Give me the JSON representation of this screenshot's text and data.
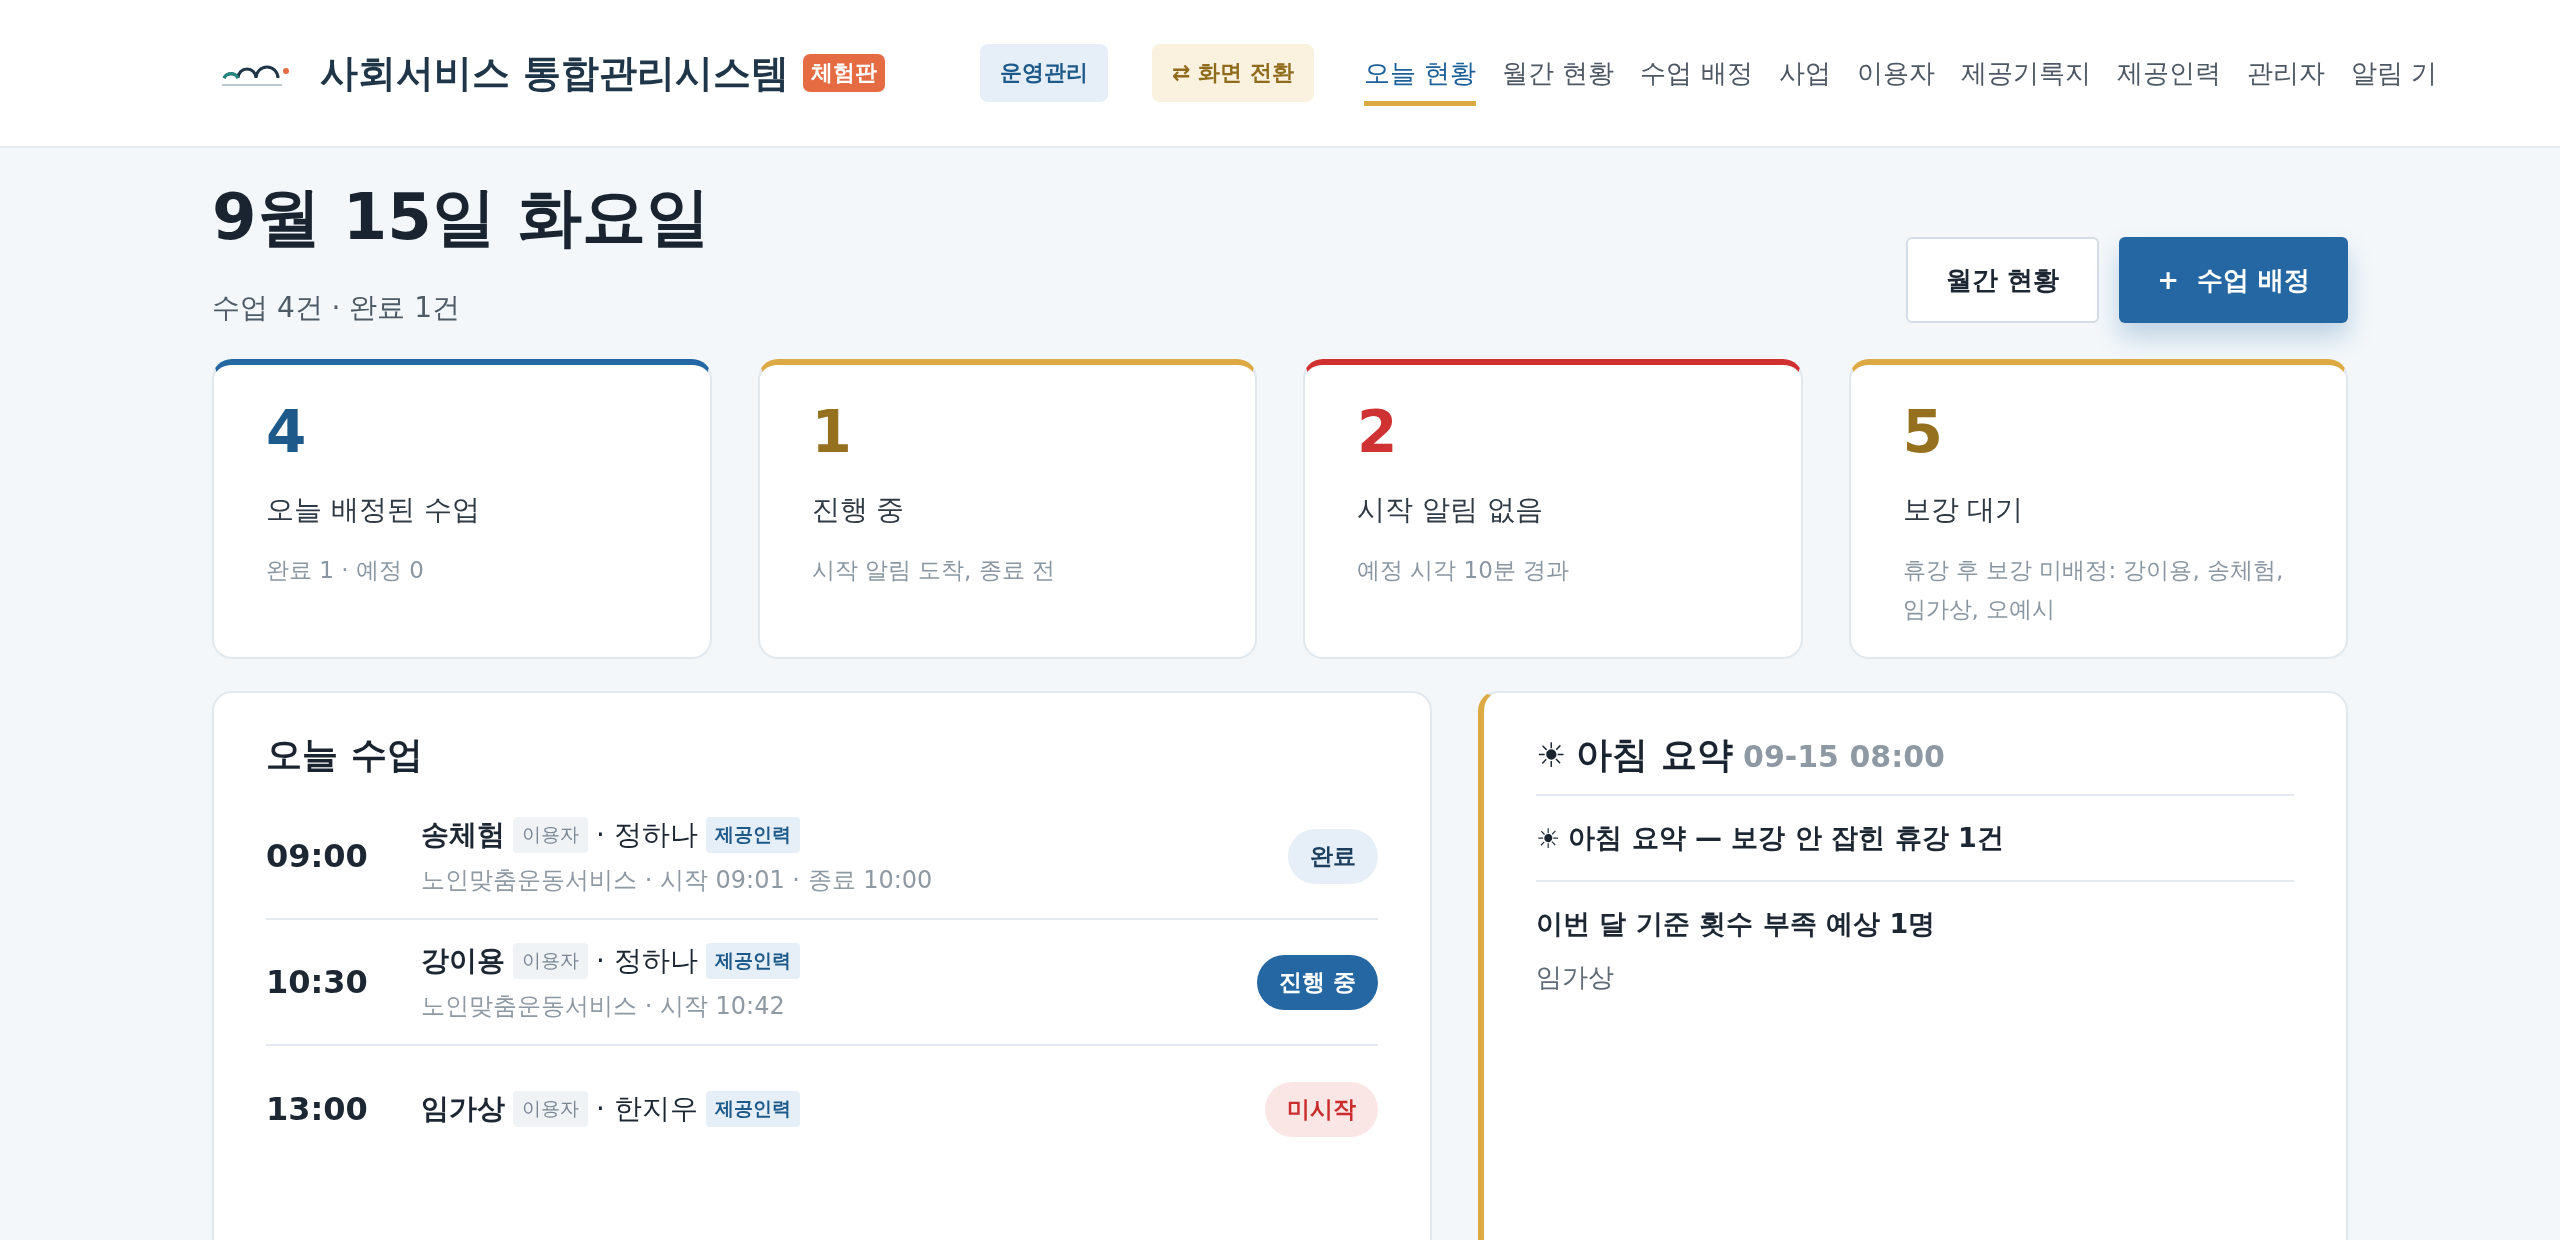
{
  "header": {
    "title": "사회서비스 통합관리시스템",
    "badge": "체험판",
    "ops_button": "운영관리",
    "switch_button": {
      "icon": "⇄",
      "label": "화면 전환"
    },
    "nav": [
      {
        "label": "오늘 현황",
        "selected": true
      },
      {
        "label": "월간 현황",
        "selected": false
      },
      {
        "label": "수업 배정",
        "selected": false
      },
      {
        "label": "사업",
        "selected": false
      },
      {
        "label": "이용자",
        "selected": false
      },
      {
        "label": "제공기록지",
        "selected": false
      },
      {
        "label": "제공인력",
        "selected": false
      },
      {
        "label": "관리자",
        "selected": false
      },
      {
        "label": "알림 기",
        "selected": false
      }
    ]
  },
  "page": {
    "title": "9월 15일 화요일",
    "subtitle": "수업 4건 · 완료 1건",
    "monthly_button": "월간 현황",
    "assign_button": {
      "icon": "+",
      "label": "수업 배정"
    }
  },
  "stats": [
    {
      "kind": "blue",
      "value": "4",
      "label": "오늘 배정된 수업",
      "detail": "완료 1 · 예정 0"
    },
    {
      "kind": "amber",
      "value": "1",
      "label": "진행 중",
      "detail": "시작 알림 도착, 종료 전"
    },
    {
      "kind": "red",
      "value": "2",
      "label": "시작 알림 없음",
      "detail": "예정 시각 10분 경과"
    },
    {
      "kind": "amber",
      "value": "5",
      "label": "보강 대기",
      "detail": "휴강 후 보강 미배정: 강이용, 송체험, 임가상, 오예시"
    }
  ],
  "today": {
    "title": "오늘 수업",
    "rows": [
      {
        "time": "09:00",
        "client": "송체험",
        "client_tag": "이용자",
        "provider": "· 정하나",
        "provider_tag": "제공인력",
        "detail": "노인맞춤운동서비스 · 시작 09:01 · 종료 10:00",
        "status": {
          "kind": "done",
          "label": "완료"
        }
      },
      {
        "time": "10:30",
        "client": "강이용",
        "client_tag": "이용자",
        "provider": "· 정하나",
        "provider_tag": "제공인력",
        "detail": "노인맞춤운동서비스 · 시작 10:42",
        "status": {
          "kind": "active",
          "label": "진행 중"
        }
      },
      {
        "time": "13:00",
        "client": "임가상",
        "client_tag": "이용자",
        "provider": "· 한지우",
        "provider_tag": "제공인력",
        "status": {
          "kind": "missing",
          "label": "미시작"
        }
      }
    ]
  },
  "summary": {
    "icon": "☀",
    "title": "아침 요약",
    "time": "09-15 08:00",
    "items": [
      {
        "kind": "heading",
        "icon": "☀",
        "text": "아침 요약 — 보강 안 잡힌 휴강 1건"
      },
      {
        "kind": "block",
        "text": "이번 달 기준 횟수 부족 예상 1명",
        "detail": "임가상"
      }
    ]
  }
}
